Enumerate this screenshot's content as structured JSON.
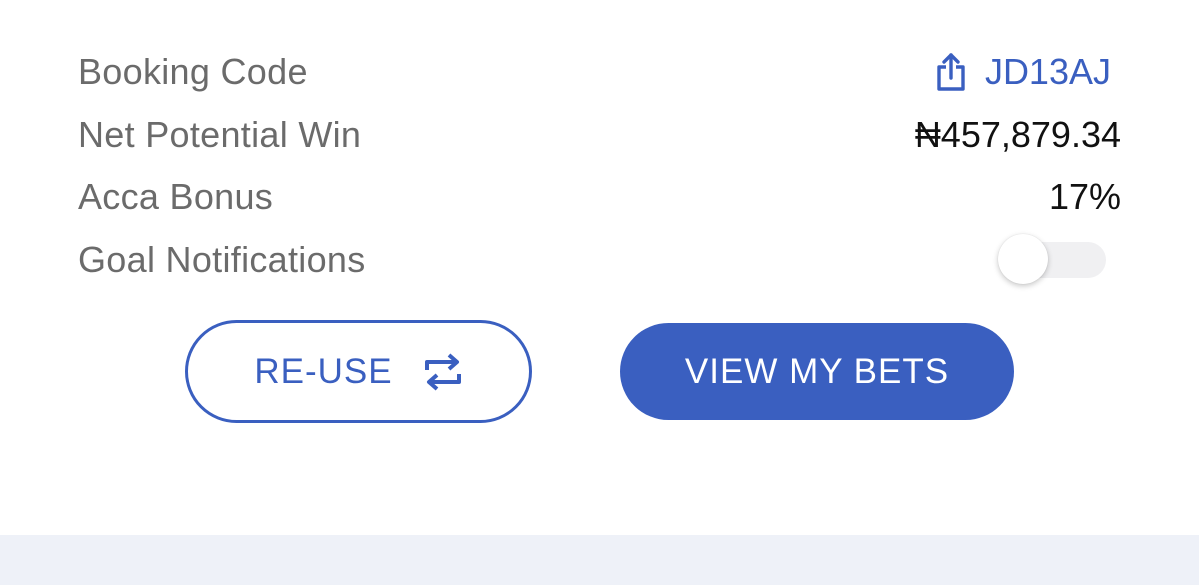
{
  "rows": {
    "booking_code": {
      "label": "Booking Code",
      "value": "JD13AJ",
      "icon": "share-icon"
    },
    "net_potential_win": {
      "label": "Net Potential Win",
      "value": "₦457,879.34"
    },
    "acca_bonus": {
      "label": "Acca Bonus",
      "value": "17%"
    },
    "goal_notifications": {
      "label": "Goal Notifications",
      "enabled": false
    }
  },
  "actions": {
    "reuse_label": "RE-USE",
    "reuse_icon": "repeat-icon",
    "view_bets_label": "VIEW MY BETS"
  },
  "colors": {
    "accent": "#3a5fc0",
    "label_text": "#6b6b6b",
    "value_text": "#111111",
    "footer_band": "#eef1f8"
  }
}
